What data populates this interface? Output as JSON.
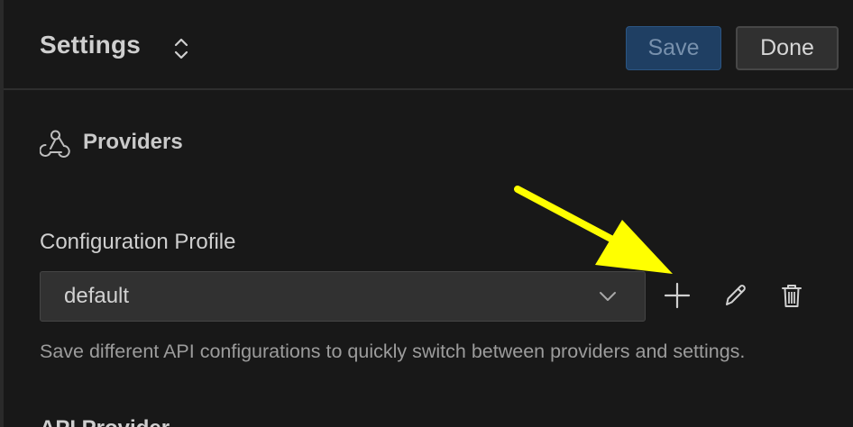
{
  "header": {
    "title": "Settings",
    "save_label": "Save",
    "done_label": "Done"
  },
  "section": {
    "title": "Providers",
    "icon": "webhook-icon"
  },
  "config_profile": {
    "label": "Configuration Profile",
    "selected": "default",
    "help_text": "Save different API configurations to quickly switch between providers and settings.",
    "actions": [
      "plus-icon",
      "pencil-icon",
      "trash-icon"
    ]
  },
  "next_section": {
    "label": "API Provider"
  },
  "colors": {
    "background": "#181818",
    "save_button": "#1f3f63",
    "annotation_arrow": "#ffff00"
  }
}
